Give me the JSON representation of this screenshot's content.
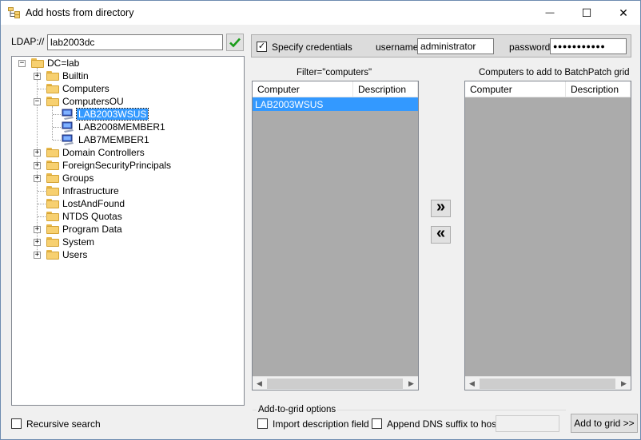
{
  "window": {
    "title": "Add hosts from directory",
    "controls": {
      "minimize": "—",
      "maximize": "☐",
      "close": "✕"
    }
  },
  "ldap": {
    "label": "LDAP://",
    "value": "lab2003dc",
    "go_icon": "checkmark-icon"
  },
  "tree": {
    "root": "DC=lab",
    "nodes": [
      {
        "label": "Builtin",
        "expandable": true
      },
      {
        "label": "Computers",
        "expandable": false
      },
      {
        "label": "ComputersOU",
        "expandable": true,
        "expanded": true,
        "children": [
          "LAB2003WSUS",
          "LAB2008MEMBER1",
          "LAB7MEMBER1"
        ]
      },
      {
        "label": "Domain Controllers",
        "expandable": true
      },
      {
        "label": "ForeignSecurityPrincipals",
        "expandable": true
      },
      {
        "label": "Groups",
        "expandable": true
      },
      {
        "label": "Infrastructure",
        "expandable": false
      },
      {
        "label": "LostAndFound",
        "expandable": false
      },
      {
        "label": "NTDS Quotas",
        "expandable": false
      },
      {
        "label": "Program Data",
        "expandable": true
      },
      {
        "label": "System",
        "expandable": true
      },
      {
        "label": "Users",
        "expandable": true
      }
    ],
    "selected": "LAB2003WSUS"
  },
  "credentials": {
    "specify_label": "Specify credentials",
    "specify_checked": true,
    "username_label": "username:",
    "username_value": "administrator",
    "password_label": "password:",
    "password_value": "●●●●●●●●●●●"
  },
  "left_list": {
    "caption": "Filter=\"computers\"",
    "columns": [
      "Computer",
      "Description"
    ],
    "rows": [
      {
        "computer": "LAB2003WSUS",
        "description": ""
      }
    ]
  },
  "right_list": {
    "caption": "Computers to add to BatchPatch grid",
    "columns": [
      "Computer",
      "Description"
    ],
    "rows": []
  },
  "transfer": {
    "add_label": "»",
    "remove_label": "«"
  },
  "options": {
    "recursive_label": "Recursive search",
    "recursive_checked": false,
    "group_label": "Add-to-grid options",
    "import_desc_label": "Import description field",
    "import_desc_checked": false,
    "dns_suffix_label": "Append DNS suffix to hosts:",
    "dns_suffix_checked": false,
    "dns_suffix_value": ""
  },
  "actions": {
    "add_to_grid_label": "Add to grid >>"
  },
  "colors": {
    "selection": "#3399ff",
    "list_background": "#ababab",
    "check_green": "#1a9c1a"
  }
}
